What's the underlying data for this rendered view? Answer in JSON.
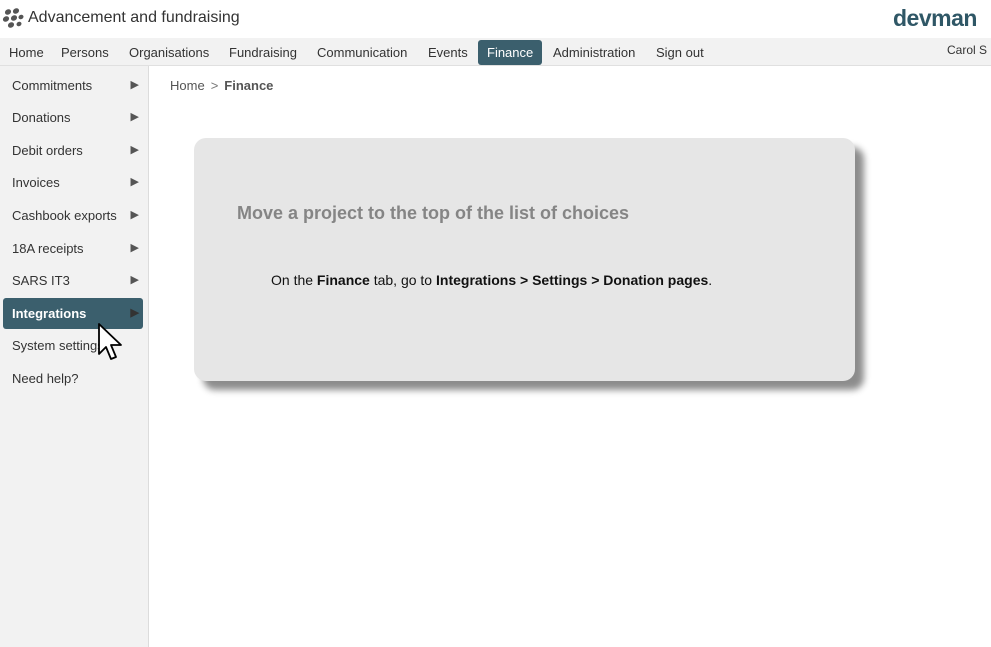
{
  "app": {
    "title": "Advancement and fundraising",
    "brand": "devman",
    "user": "Carol S"
  },
  "nav": {
    "items": [
      {
        "label": "Home"
      },
      {
        "label": "Persons"
      },
      {
        "label": "Organisations"
      },
      {
        "label": "Fundraising"
      },
      {
        "label": "Communication"
      },
      {
        "label": "Events"
      },
      {
        "label": "Finance",
        "active": true
      },
      {
        "label": "Administration"
      },
      {
        "label": "Sign out"
      }
    ]
  },
  "sidebar": {
    "items": [
      {
        "label": "Commitments",
        "arrow": "▶"
      },
      {
        "label": "Donations",
        "arrow": "▶"
      },
      {
        "label": "Debit orders",
        "arrow": "▶"
      },
      {
        "label": "Invoices",
        "arrow": "▶"
      },
      {
        "label": "Cashbook exports",
        "arrow": "▶"
      },
      {
        "label": "18A receipts",
        "arrow": "▶"
      },
      {
        "label": "SARS IT3",
        "arrow": "▶"
      },
      {
        "label": "Integrations",
        "arrow": "▶",
        "active": true
      },
      {
        "label": "System settings"
      },
      {
        "label": "Need help?"
      }
    ]
  },
  "breadcrumb": {
    "home": "Home",
    "separator": ">",
    "current": "Finance"
  },
  "card": {
    "title": "Move a project to the top of the list of choices",
    "text": {
      "part1": "On the ",
      "tab": "Finance",
      "part2": " tab, go to ",
      "path": "Integrations > Settings > Donation pages",
      "part3": "."
    }
  },
  "colors": {
    "accent": "#3b5f6d",
    "brand": "#2f5766",
    "card_background": "#e6e6e6",
    "sidebar_background": "#f2f2f2"
  }
}
